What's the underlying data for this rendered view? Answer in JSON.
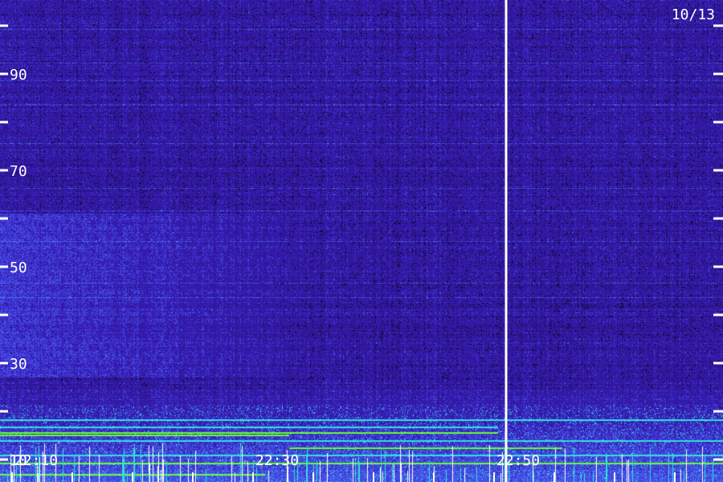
{
  "chart_data": {
    "type": "heatmap",
    "date_label": "10/13",
    "y_tick_labels": [
      "10",
      "30",
      "50",
      "70",
      "90"
    ],
    "y_ticks": [
      10,
      20,
      30,
      40,
      50,
      60,
      70,
      80,
      90,
      100
    ],
    "y_range": [
      10,
      100
    ],
    "x_tick_labels": [
      "22:10",
      "22:30",
      "22:50"
    ],
    "x_range": [
      "22:07",
      "22:67"
    ],
    "marker_time": "22:49",
    "colors": {
      "background": "#1a0a4a",
      "noise_low": "#2a14a0",
      "noise_high": "#4d2cff",
      "line_cyan": "#33e0e0",
      "line_green": "#66ff33",
      "marker": "#ffffff",
      "tick": "#ffffff"
    }
  }
}
